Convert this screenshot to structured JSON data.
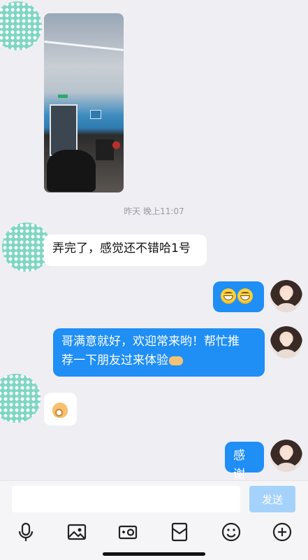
{
  "chat": {
    "timestamp": "昨天 晚上11:07",
    "messages": [
      {
        "side": "left",
        "text": "弄完了，感觉还不错哈1号"
      },
      {
        "side": "right",
        "text": ""
      },
      {
        "side": "right",
        "text_line1": "哥满意就好，欢迎常来哟！帮忙推",
        "text_line2": "荐一下朋友过来体验"
      },
      {
        "side": "left",
        "text": ""
      },
      {
        "side": "right",
        "text": "感谢"
      }
    ]
  },
  "input": {
    "value": "",
    "placeholder": ""
  },
  "send_button": {
    "label": "发送"
  },
  "toolbar": {
    "icons": [
      "microphone-icon",
      "image-icon",
      "camera-icon",
      "red-envelope-icon",
      "emoji-icon",
      "plus-icon"
    ]
  },
  "colors": {
    "bubble_right": "#1f8ef5",
    "bubble_left": "#ffffff",
    "send_disabled": "#a5d2fb",
    "avatar_dots": "#7fd6c4"
  }
}
